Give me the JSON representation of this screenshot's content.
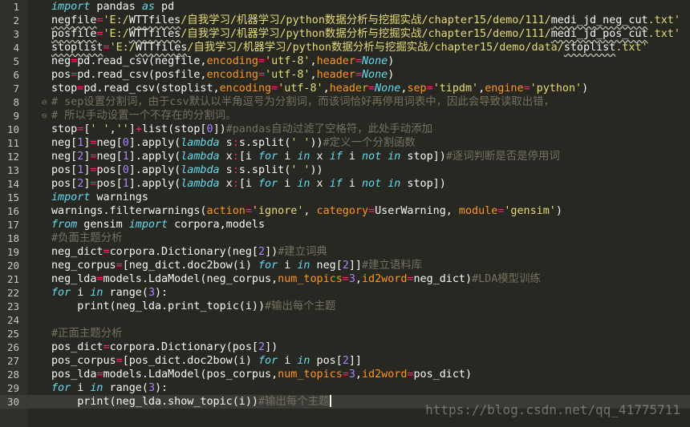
{
  "editor": {
    "theme_colors": {
      "background": "#272822",
      "keyword": "#66d9ef",
      "string": "#e6db74",
      "argument": "#fd971f",
      "operator": "#f92672",
      "number": "#ae81ff",
      "comment": "#75715e"
    },
    "active_line": 30,
    "lines": [
      {
        "n": "1",
        "t": [
          [
            "kw",
            "import"
          ],
          [
            "plain",
            " pandas "
          ],
          [
            "kw",
            "as"
          ],
          [
            "plain",
            " pd"
          ]
        ]
      },
      {
        "n": "2",
        "t": [
          [
            "sq",
            "negfile"
          ],
          [
            "op",
            "="
          ],
          [
            "str",
            "'E:/"
          ],
          [
            "sq",
            "WTTfiles"
          ],
          [
            "str",
            "/自我学习/机器学习/python数据分析与挖掘实战/chapter15/demo/111/"
          ],
          [
            "sq",
            "medi_jd_neg_cut"
          ],
          [
            "str",
            ".txt'"
          ]
        ]
      },
      {
        "n": "3",
        "t": [
          [
            "sq",
            "posfile"
          ],
          [
            "op",
            "="
          ],
          [
            "str",
            "'E:/"
          ],
          [
            "sq",
            "WTTfiles"
          ],
          [
            "str",
            "/自我学习/机器学习/python数据分析与挖掘实战/chapter15/demo/111/"
          ],
          [
            "sq",
            "medi_jd_pos_cut"
          ],
          [
            "str",
            ".txt'"
          ]
        ]
      },
      {
        "n": "4",
        "t": [
          [
            "sq",
            "stoplist"
          ],
          [
            "op",
            "="
          ],
          [
            "str",
            "'E:/"
          ],
          [
            "sq",
            "WTTfiles"
          ],
          [
            "str",
            "/自我学习/机器学习/python数据分析与挖掘实战/chapter15/demo/data/"
          ],
          [
            "sq",
            "stoplist"
          ],
          [
            "str",
            ".txt'"
          ]
        ]
      },
      {
        "n": "5",
        "t": [
          [
            "plain",
            "neg"
          ],
          [
            "op",
            "="
          ],
          [
            "plain",
            "pd.read_csv(negfile,"
          ],
          [
            "arg",
            "encoding"
          ],
          [
            "op",
            "="
          ],
          [
            "str",
            "'utf-8'"
          ],
          [
            "plain",
            ","
          ],
          [
            "arg",
            "header"
          ],
          [
            "op",
            "="
          ],
          [
            "kw",
            "None"
          ],
          [
            "plain",
            ")"
          ]
        ]
      },
      {
        "n": "6",
        "t": [
          [
            "plain",
            "pos"
          ],
          [
            "op",
            "="
          ],
          [
            "plain",
            "pd.read_csv(posfile,"
          ],
          [
            "arg",
            "encoding"
          ],
          [
            "op",
            "="
          ],
          [
            "str",
            "'utf-8'"
          ],
          [
            "plain",
            ","
          ],
          [
            "arg",
            "header"
          ],
          [
            "op",
            "="
          ],
          [
            "kw",
            "None"
          ],
          [
            "plain",
            ")"
          ]
        ]
      },
      {
        "n": "7",
        "t": [
          [
            "plain",
            "stop"
          ],
          [
            "op",
            "="
          ],
          [
            "plain",
            "pd.read_csv(stoplist,"
          ],
          [
            "arg",
            "encoding"
          ],
          [
            "op",
            "="
          ],
          [
            "str",
            "'utf-8'"
          ],
          [
            "plain",
            ","
          ],
          [
            "arg",
            "header"
          ],
          [
            "op",
            "="
          ],
          [
            "kw",
            "None"
          ],
          [
            "plain",
            ","
          ],
          [
            "arg",
            "sep"
          ],
          [
            "op",
            "="
          ],
          [
            "str",
            "'tipdm'"
          ],
          [
            "plain",
            ","
          ],
          [
            "arg",
            "engine"
          ],
          [
            "op",
            "="
          ],
          [
            "str",
            "'python'"
          ],
          [
            "plain",
            ")"
          ]
        ]
      },
      {
        "n": "8",
        "f": "⊖",
        "t": [
          [
            "com",
            "# sep设置分割词，由于csv默认以半角逗号为分割词，而该词恰好再停用词表中，因此会导致读取出错，"
          ]
        ]
      },
      {
        "n": "9",
        "f": "⊖",
        "t": [
          [
            "com",
            "# 所以手动设置一个不存在的分割词。"
          ]
        ]
      },
      {
        "n": "10",
        "t": [
          [
            "plain",
            "stop"
          ],
          [
            "op",
            "="
          ],
          [
            "plain",
            "["
          ],
          [
            "str",
            "' '"
          ],
          [
            "plain",
            ","
          ],
          [
            "str",
            "''"
          ],
          [
            "plain",
            "]"
          ],
          [
            "op",
            "+"
          ],
          [
            "plain",
            "list(stop["
          ],
          [
            "num",
            "0"
          ],
          [
            "plain",
            "])"
          ],
          [
            "com",
            "#pandas自动过滤了空格符，此处手动添加"
          ]
        ]
      },
      {
        "n": "11",
        "t": [
          [
            "plain",
            "neg["
          ],
          [
            "num",
            "1"
          ],
          [
            "plain",
            "]"
          ],
          [
            "op",
            "="
          ],
          [
            "plain",
            "neg["
          ],
          [
            "num",
            "0"
          ],
          [
            "plain",
            "].apply("
          ],
          [
            "kw",
            "lambda"
          ],
          [
            "plain",
            " s"
          ],
          [
            "op",
            ":"
          ],
          [
            "plain",
            "s.split("
          ],
          [
            "str",
            "' '"
          ],
          [
            "plain",
            "))"
          ],
          [
            "com",
            "#定义一个分割函数"
          ]
        ]
      },
      {
        "n": "12",
        "t": [
          [
            "plain",
            "neg["
          ],
          [
            "num",
            "2"
          ],
          [
            "plain",
            "]"
          ],
          [
            "op",
            "="
          ],
          [
            "plain",
            "neg["
          ],
          [
            "num",
            "1"
          ],
          [
            "plain",
            "].apply("
          ],
          [
            "kw",
            "lambda"
          ],
          [
            "plain",
            " x"
          ],
          [
            "op",
            ":"
          ],
          [
            "plain",
            "[i "
          ],
          [
            "kw",
            "for"
          ],
          [
            "plain",
            " i "
          ],
          [
            "kw",
            "in"
          ],
          [
            "plain",
            " x "
          ],
          [
            "kw",
            "if"
          ],
          [
            "plain",
            " i "
          ],
          [
            "kw",
            "not in"
          ],
          [
            "plain",
            " stop])"
          ],
          [
            "com",
            "#逐词判断是否是停用词"
          ]
        ]
      },
      {
        "n": "13",
        "t": [
          [
            "plain",
            "pos["
          ],
          [
            "num",
            "1"
          ],
          [
            "plain",
            "]"
          ],
          [
            "op",
            "="
          ],
          [
            "plain",
            "pos["
          ],
          [
            "num",
            "0"
          ],
          [
            "plain",
            "].apply("
          ],
          [
            "kw",
            "lambda"
          ],
          [
            "plain",
            " s"
          ],
          [
            "op",
            ":"
          ],
          [
            "plain",
            "s.split("
          ],
          [
            "str",
            "' '"
          ],
          [
            "plain",
            "))"
          ]
        ]
      },
      {
        "n": "14",
        "t": [
          [
            "plain",
            "pos["
          ],
          [
            "num",
            "2"
          ],
          [
            "plain",
            "]"
          ],
          [
            "op",
            "="
          ],
          [
            "plain",
            "pos["
          ],
          [
            "num",
            "1"
          ],
          [
            "plain",
            "].apply("
          ],
          [
            "kw",
            "lambda"
          ],
          [
            "plain",
            " x"
          ],
          [
            "op",
            ":"
          ],
          [
            "plain",
            "[i "
          ],
          [
            "kw",
            "for"
          ],
          [
            "plain",
            " i "
          ],
          [
            "kw",
            "in"
          ],
          [
            "plain",
            " x "
          ],
          [
            "kw",
            "if"
          ],
          [
            "plain",
            " i "
          ],
          [
            "kw",
            "not in"
          ],
          [
            "plain",
            " stop])"
          ]
        ]
      },
      {
        "n": "15",
        "t": [
          [
            "kw",
            "import"
          ],
          [
            "plain",
            " warnings"
          ]
        ]
      },
      {
        "n": "16",
        "t": [
          [
            "plain",
            "warnings.filterwarnings("
          ],
          [
            "arg",
            "action"
          ],
          [
            "op",
            "="
          ],
          [
            "str",
            "'ignore'"
          ],
          [
            "plain",
            ", "
          ],
          [
            "arg",
            "category"
          ],
          [
            "op",
            "="
          ],
          [
            "plain",
            "UserWarning, "
          ],
          [
            "arg",
            "module"
          ],
          [
            "op",
            "="
          ],
          [
            "str",
            "'gensim'"
          ],
          [
            "plain",
            ")"
          ]
        ]
      },
      {
        "n": "17",
        "t": [
          [
            "kw",
            "from"
          ],
          [
            "plain",
            " gensim "
          ],
          [
            "kw",
            "import"
          ],
          [
            "plain",
            " corpora,models"
          ]
        ]
      },
      {
        "n": "18",
        "t": [
          [
            "com",
            "#负面主题分析"
          ]
        ]
      },
      {
        "n": "19",
        "t": [
          [
            "plain",
            "neg_dict"
          ],
          [
            "op",
            "="
          ],
          [
            "plain",
            "corpora.Dictionary(neg["
          ],
          [
            "num",
            "2"
          ],
          [
            "plain",
            "])"
          ],
          [
            "com",
            "#建立词典"
          ]
        ]
      },
      {
        "n": "20",
        "t": [
          [
            "plain",
            "neg_corpus"
          ],
          [
            "op",
            "="
          ],
          [
            "plain",
            "[neg_dict.doc2bow(i) "
          ],
          [
            "kw",
            "for"
          ],
          [
            "plain",
            " i "
          ],
          [
            "kw",
            "in"
          ],
          [
            "plain",
            " neg["
          ],
          [
            "num",
            "2"
          ],
          [
            "plain",
            "]]"
          ],
          [
            "com",
            "#建立语料库"
          ]
        ]
      },
      {
        "n": "21",
        "t": [
          [
            "plain",
            "neg_lda"
          ],
          [
            "op",
            "="
          ],
          [
            "plain",
            "models.LdaModel(neg_corpus,"
          ],
          [
            "arg",
            "num_topics"
          ],
          [
            "op",
            "="
          ],
          [
            "num",
            "3"
          ],
          [
            "plain",
            ","
          ],
          [
            "arg",
            "id2word"
          ],
          [
            "op",
            "="
          ],
          [
            "plain",
            "neg_dict)"
          ],
          [
            "com",
            "#LDA模型训练"
          ]
        ]
      },
      {
        "n": "22",
        "t": [
          [
            "kw",
            "for"
          ],
          [
            "plain",
            " i "
          ],
          [
            "kw",
            "in"
          ],
          [
            "plain",
            " range("
          ],
          [
            "num",
            "3"
          ],
          [
            "plain",
            "):"
          ]
        ]
      },
      {
        "n": "23",
        "t": [
          [
            "plain",
            "    print(neg_lda.print_topic(i))"
          ],
          [
            "com",
            "#输出每个主题"
          ]
        ]
      },
      {
        "n": "24",
        "t": []
      },
      {
        "n": "25",
        "t": [
          [
            "com",
            "#正面主题分析"
          ]
        ]
      },
      {
        "n": "26",
        "t": [
          [
            "plain",
            "pos_dict"
          ],
          [
            "op",
            "="
          ],
          [
            "plain",
            "corpora.Dictionary(pos["
          ],
          [
            "num",
            "2"
          ],
          [
            "plain",
            "])"
          ]
        ]
      },
      {
        "n": "27",
        "t": [
          [
            "plain",
            "pos_corpus"
          ],
          [
            "op",
            "="
          ],
          [
            "plain",
            "[pos_dict.doc2bow(i) "
          ],
          [
            "kw",
            "for"
          ],
          [
            "plain",
            " i "
          ],
          [
            "kw",
            "in"
          ],
          [
            "plain",
            " pos["
          ],
          [
            "num",
            "2"
          ],
          [
            "plain",
            "]]"
          ]
        ]
      },
      {
        "n": "28",
        "t": [
          [
            "plain",
            "pos_lda"
          ],
          [
            "op",
            "="
          ],
          [
            "plain",
            "models.LdaModel(pos_corpus,"
          ],
          [
            "arg",
            "num_topics"
          ],
          [
            "op",
            "="
          ],
          [
            "num",
            "3"
          ],
          [
            "plain",
            ","
          ],
          [
            "arg",
            "id2word"
          ],
          [
            "op",
            "="
          ],
          [
            "plain",
            "pos_dict)"
          ]
        ]
      },
      {
        "n": "29",
        "t": [
          [
            "kw",
            "for"
          ],
          [
            "plain",
            " i "
          ],
          [
            "kw",
            "in"
          ],
          [
            "plain",
            " range("
          ],
          [
            "num",
            "3"
          ],
          [
            "plain",
            "):"
          ]
        ]
      },
      {
        "n": "30",
        "t": [
          [
            "plain",
            "    print(neg_lda.show_topic(i))"
          ],
          [
            "com",
            "#输出每个主题"
          ]
        ]
      }
    ]
  },
  "watermark": "https://blog.csdn.net/qq_41775711"
}
